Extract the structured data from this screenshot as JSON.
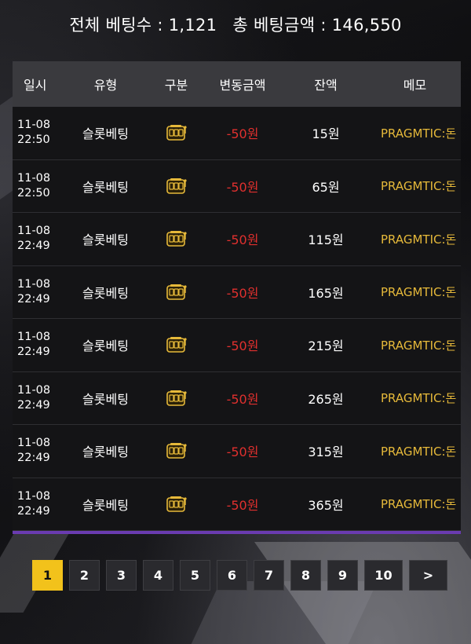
{
  "summary": {
    "bet_count_label": "전체 베팅수 : 1,121",
    "bet_total_label": "총 베팅금액 : 146,550"
  },
  "table": {
    "headers": {
      "date": "일시",
      "type": "유형",
      "category": "구분",
      "change": "변동금액",
      "balance": "잔액",
      "memo": "메모"
    },
    "rows": [
      {
        "date": "11-08",
        "time": "22:50",
        "type": "슬롯베팅",
        "icon": "slot-machine-icon",
        "change": "-50원",
        "balance": "15원",
        "memo": "PRAGMTIC:돈"
      },
      {
        "date": "11-08",
        "time": "22:50",
        "type": "슬롯베팅",
        "icon": "slot-machine-icon",
        "change": "-50원",
        "balance": "65원",
        "memo": "PRAGMTIC:돈"
      },
      {
        "date": "11-08",
        "time": "22:49",
        "type": "슬롯베팅",
        "icon": "slot-machine-icon",
        "change": "-50원",
        "balance": "115원",
        "memo": "PRAGMTIC:돈"
      },
      {
        "date": "11-08",
        "time": "22:49",
        "type": "슬롯베팅",
        "icon": "slot-machine-icon",
        "change": "-50원",
        "balance": "165원",
        "memo": "PRAGMTIC:돈"
      },
      {
        "date": "11-08",
        "time": "22:49",
        "type": "슬롯베팅",
        "icon": "slot-machine-icon",
        "change": "-50원",
        "balance": "215원",
        "memo": "PRAGMTIC:돈"
      },
      {
        "date": "11-08",
        "time": "22:49",
        "type": "슬롯베팅",
        "icon": "slot-machine-icon",
        "change": "-50원",
        "balance": "265원",
        "memo": "PRAGMTIC:돈"
      },
      {
        "date": "11-08",
        "time": "22:49",
        "type": "슬롯베팅",
        "icon": "slot-machine-icon",
        "change": "-50원",
        "balance": "315원",
        "memo": "PRAGMTIC:돈"
      },
      {
        "date": "11-08",
        "time": "22:49",
        "type": "슬롯베팅",
        "icon": "slot-machine-icon",
        "change": "-50원",
        "balance": "365원",
        "memo": "PRAGMTIC:돈"
      }
    ]
  },
  "pagination": {
    "pages": [
      "1",
      "2",
      "3",
      "4",
      "5",
      "6",
      "7",
      "8",
      "9",
      "10"
    ],
    "current": "1",
    "next_label": ">"
  },
  "colors": {
    "accent": "#f2c21b",
    "negative_amount": "#e0302e",
    "memo_text": "#e6b93a",
    "table_divider": "#6a3bb0"
  }
}
